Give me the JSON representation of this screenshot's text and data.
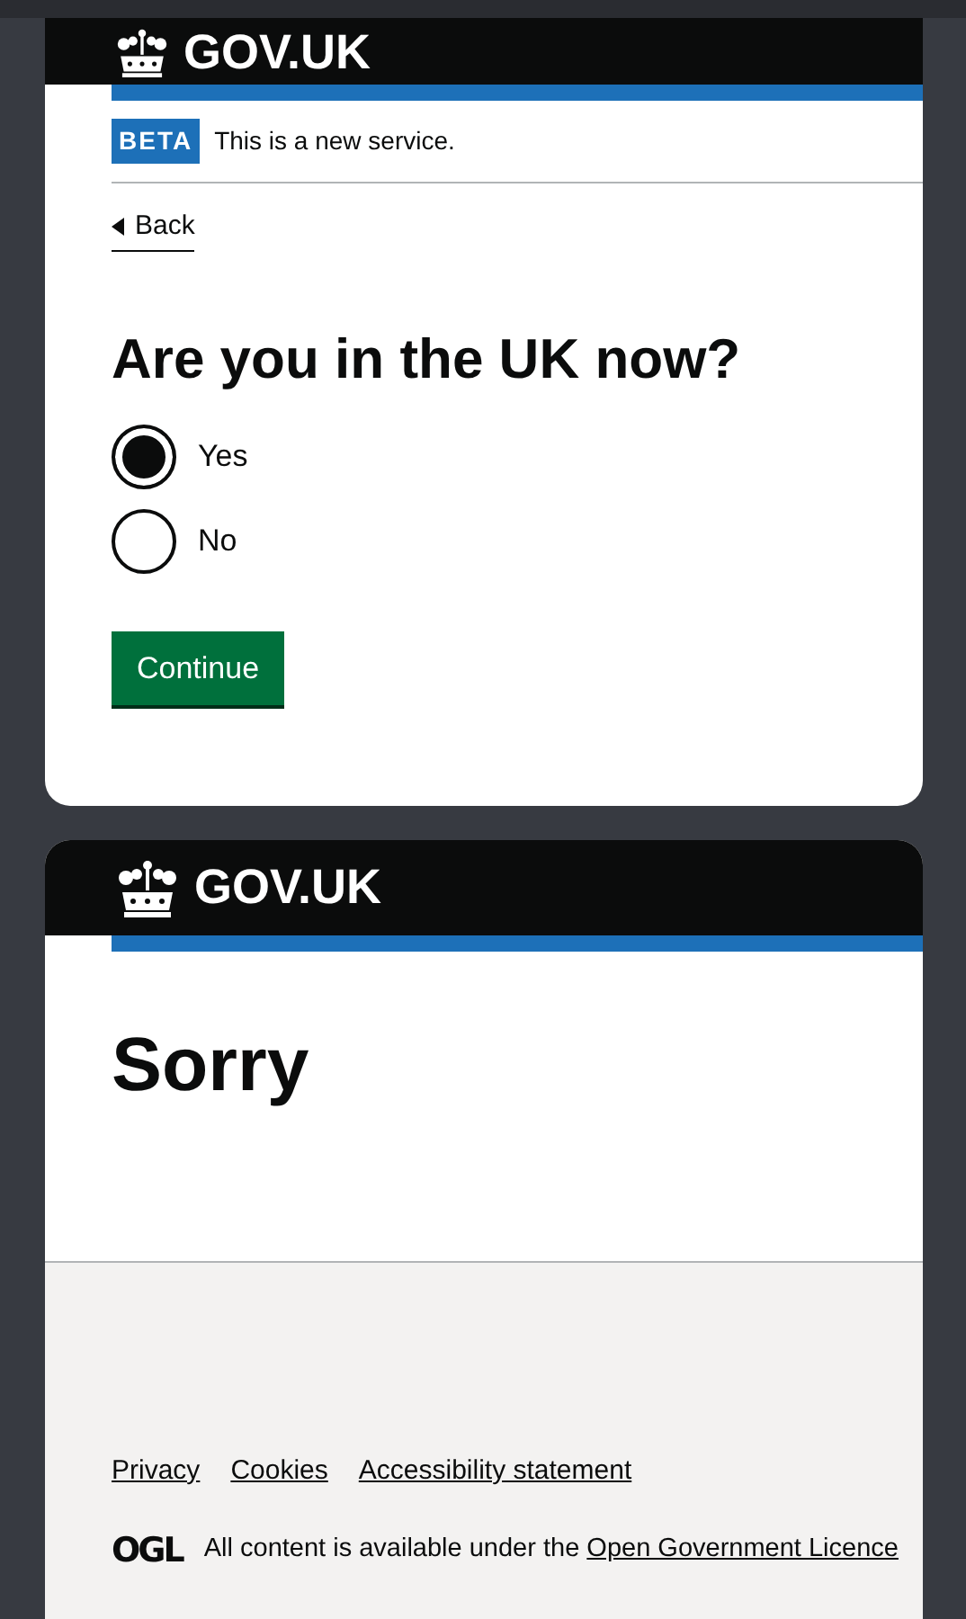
{
  "screens": [
    {
      "kind": "question",
      "logo": "GOV.UK",
      "phase": {
        "tag": "BETA",
        "text": "This is a new service."
      },
      "back_link": "Back",
      "heading": "Are you in the UK now?",
      "options": [
        {
          "label": "Yes",
          "selected": true
        },
        {
          "label": "No",
          "selected": false
        }
      ],
      "button": "Continue"
    },
    {
      "kind": "error",
      "logo": "GOV.UK",
      "heading": "Sorry",
      "footer": {
        "links": [
          "Privacy",
          "Cookies",
          "Accessibility statement"
        ],
        "licence_logo": "OGL",
        "licence_text": "All content is available under the ",
        "licence_link": "Open Government Licence"
      }
    }
  ]
}
